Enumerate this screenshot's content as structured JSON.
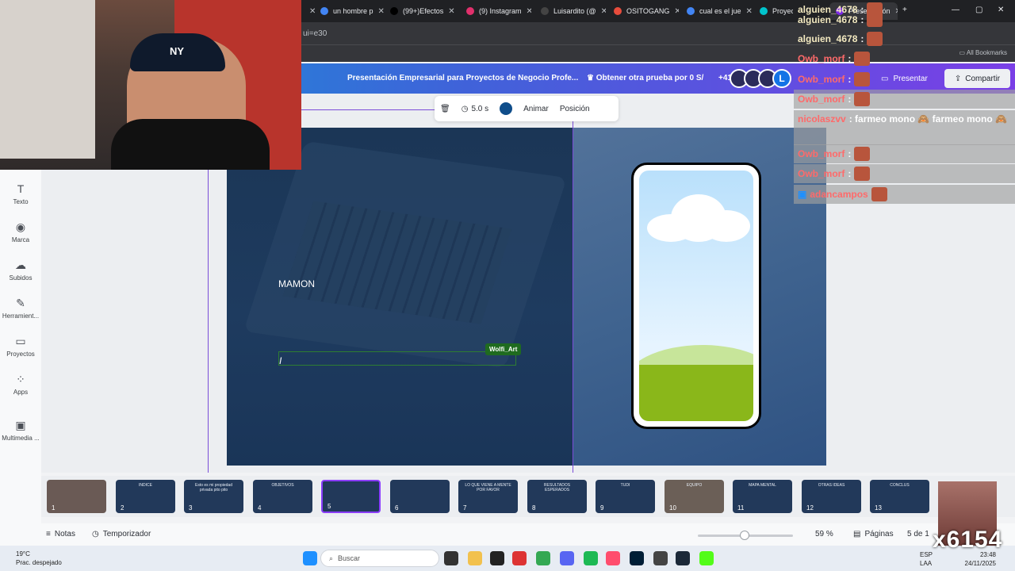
{
  "browser": {
    "tabs": [
      {
        "label": "un hombre p",
        "color": "#4285f4"
      },
      {
        "label": "(99+)Efectos",
        "color": "#000000"
      },
      {
        "label": "(9) Instagram",
        "color": "#e1306c"
      },
      {
        "label": "Luisardito (@",
        "color": "#000000"
      },
      {
        "label": "OSITOGANG",
        "color": "#e74c3c"
      },
      {
        "label": "cual es el jue",
        "color": "#4285f4"
      },
      {
        "label": "Proyectos",
        "color": "#00c4cc"
      },
      {
        "label": "Presentación",
        "color": "#7d2ae8"
      }
    ],
    "url": "ui=e30",
    "all_bookmarks": "All Bookmarks"
  },
  "header": {
    "doc_title": "Presentación Empresarial para Proyectos de Negocio Profe...",
    "promo": "Obtener otra prueba por 0 S/",
    "collab_count": "+41",
    "avatar_letter": "L",
    "present": "Presentar",
    "share": "Compartir"
  },
  "sidebar": {
    "items": [
      {
        "label": "Texto",
        "icon": "text-icon"
      },
      {
        "label": "Marca",
        "icon": "brand-icon"
      },
      {
        "label": "Subidos",
        "icon": "upload-icon"
      },
      {
        "label": "Herramient...",
        "icon": "tools-icon"
      },
      {
        "label": "Proyectos",
        "icon": "folder-icon"
      },
      {
        "label": "Apps",
        "icon": "apps-icon"
      },
      {
        "label": "Multimedia ...",
        "icon": "media-icon"
      }
    ]
  },
  "toolbar": {
    "duration": "5.0 s",
    "color": "#0f4d8a",
    "animate": "Animar",
    "position": "Posición"
  },
  "slide": {
    "text": "MAMON",
    "cursor_text": "I",
    "collaborator": "Wolfi_Art",
    "colors": {
      "left": "#1c3758",
      "right": "#3f638f"
    }
  },
  "thumbnails": {
    "items": [
      {
        "num": "1",
        "title": ""
      },
      {
        "num": "2",
        "title": "INDICE"
      },
      {
        "num": "3",
        "title": "Esto es mi propiedad privada pito pito"
      },
      {
        "num": "4",
        "title": "OBJETIVOS"
      },
      {
        "num": "5",
        "title": ""
      },
      {
        "num": "6",
        "title": ""
      },
      {
        "num": "7",
        "title": "LO QUE VIENE A MENTE POR FAVOR"
      },
      {
        "num": "8",
        "title": "RESULTADOS ESPERADOS"
      },
      {
        "num": "9",
        "title": "TUDI"
      },
      {
        "num": "10",
        "title": "EQUIPO"
      },
      {
        "num": "11",
        "title": "MAPA MENTAL"
      },
      {
        "num": "12",
        "title": "OTRAS IDEAS"
      },
      {
        "num": "13",
        "title": "CONCLUS"
      }
    ],
    "selected": 5
  },
  "bottom": {
    "notes": "Notas",
    "timer": "Temporizador",
    "zoom": "59 %",
    "zoom_level": 0.59,
    "pages": "Páginas",
    "page_count": "5 de 1"
  },
  "taskbar": {
    "weather_temp": "19°C",
    "weather_desc": "Prac. despejado",
    "search_placeholder": "Buscar",
    "lang1": "ESP",
    "lang2": "LAA",
    "time": "23:48",
    "date": "24/11/2025"
  },
  "stream": {
    "chat": [
      {
        "user": "alguien_4678",
        "text": "",
        "color": "#f3e9c0"
      },
      {
        "user": "alguien_4678",
        "text": "",
        "color": "#f3e9c0"
      },
      {
        "user": "Owb_morf",
        "text": "",
        "color": "#ff6a6a"
      },
      {
        "user": "Owb_morf",
        "text": "",
        "color": "#ff6a6a"
      },
      {
        "user": "Owb_morf",
        "text": "",
        "color": "#ff6a6a"
      },
      {
        "user": "nicolaszvv",
        "text": ": farmeo mono 🙈 farmeo mono 🙈",
        "color": "#ff6a6a"
      },
      {
        "user": "Owb_morf",
        "text": "",
        "color": "#ff6a6a"
      },
      {
        "user": "Owb_morf",
        "text": "",
        "color": "#ff6a6a"
      },
      {
        "user": "adancampos",
        "text": "",
        "color": "#ff6a6a"
      }
    ],
    "cap_logo": "NY",
    "watermark": "x6154"
  }
}
